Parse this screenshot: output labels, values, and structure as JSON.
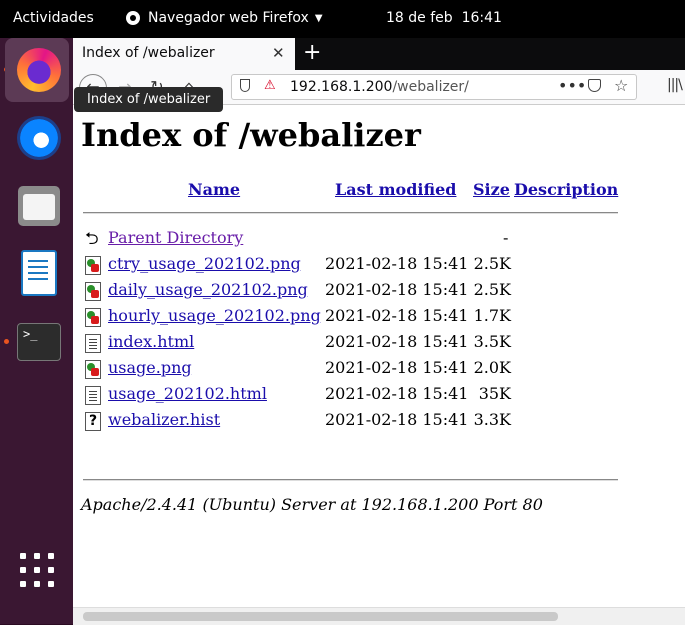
{
  "topbar": {
    "activities": "Actividades",
    "app_name": "Navegador web Firefox",
    "date": "18 de feb",
    "time": "16:41"
  },
  "dock": {
    "items": [
      "firefox-icon",
      "thunderbird-icon",
      "files-icon",
      "libreoffice-writer-icon",
      "terminal-icon"
    ],
    "show_apps": "grid-icon"
  },
  "browser": {
    "tab_title": "Index of /webalizer",
    "tooltip": "Index of /webalizer",
    "url_host": "192.168.1.200",
    "url_path": "/webalizer/"
  },
  "page": {
    "heading": "Index of /webalizer",
    "columns": {
      "name": "Name",
      "last_modified": "Last modified",
      "size": "Size",
      "description": "Description"
    },
    "parent": {
      "name": "Parent Directory",
      "size": "-"
    },
    "rows": [
      {
        "icon": "image",
        "name": "ctry_usage_202102.png",
        "modified": "2021-02-18 15:41",
        "size": "2.5K"
      },
      {
        "icon": "image",
        "name": "daily_usage_202102.png",
        "modified": "2021-02-18 15:41",
        "size": "2.5K"
      },
      {
        "icon": "image",
        "name": "hourly_usage_202102.png",
        "modified": "2021-02-18 15:41",
        "size": "1.7K"
      },
      {
        "icon": "text",
        "name": "index.html",
        "modified": "2021-02-18 15:41",
        "size": "3.5K"
      },
      {
        "icon": "image",
        "name": "usage.png",
        "modified": "2021-02-18 15:41",
        "size": "2.0K"
      },
      {
        "icon": "text",
        "name": "usage_202102.html",
        "modified": "2021-02-18 15:41",
        "size": "35K"
      },
      {
        "icon": "unknown",
        "name": "webalizer.hist",
        "modified": "2021-02-18 15:41",
        "size": "3.3K"
      }
    ],
    "address": "Apache/2.4.41 (Ubuntu) Server at 192.168.1.200 Port 80"
  },
  "colors": {
    "link": "#1a0dab",
    "visited_link": "#681da8",
    "ubuntu_orange": "#e95420",
    "dock_bg": "#3a1732"
  }
}
